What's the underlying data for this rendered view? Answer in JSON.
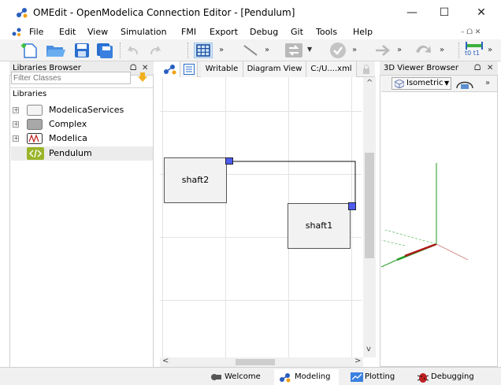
{
  "window": {
    "title": "OMEdit - OpenModelica Connection Editor - [Pendulum]",
    "minimize": "—",
    "maximize": "☐",
    "close": "✕"
  },
  "menu": {
    "file": "File",
    "edit": "Edit",
    "view": "View",
    "simulation": "Simulation",
    "fmi": "FMI",
    "export": "Export",
    "debug": "Debug",
    "git": "Git",
    "tools": "Tools",
    "help": "Help",
    "right_controls": "– ᗝ ✕"
  },
  "toolbar": {
    "more": "»",
    "t0t1": "t0 t1"
  },
  "libraries": {
    "title": "Libraries Browser",
    "float": "ᗝ",
    "close": "✕",
    "filter_placeholder": "Filter Classes",
    "root_label": "Libraries",
    "items": [
      {
        "label": "ModelicaServices",
        "expander": "+"
      },
      {
        "label": "Complex",
        "expander": "+"
      },
      {
        "label": "Modelica",
        "expander": "+"
      },
      {
        "label": "Pendulum",
        "expander": ""
      }
    ]
  },
  "editor": {
    "tabs": {
      "writable": "Writable",
      "diagram_view": "Diagram View",
      "path": "C:/U....xml"
    },
    "blocks": {
      "shaft2": "shaft2",
      "shaft1": "shaft1"
    },
    "scroll_up": "^",
    "scroll_down": "v",
    "scroll_left": "<",
    "scroll_right": ">"
  },
  "viewer": {
    "title": "3D Viewer Browser",
    "float": "ᗝ",
    "close": "✕",
    "view_mode": "Isometric",
    "more": "»"
  },
  "perspectives": {
    "welcome": "Welcome",
    "modeling": "Modeling",
    "plotting": "Plotting",
    "debugging": "Debugging"
  },
  "colors": {
    "accent": "#2a5fbf",
    "port": "#4c5cf0",
    "x_axis": "#b01818",
    "y_axis": "#1f9a1f"
  }
}
